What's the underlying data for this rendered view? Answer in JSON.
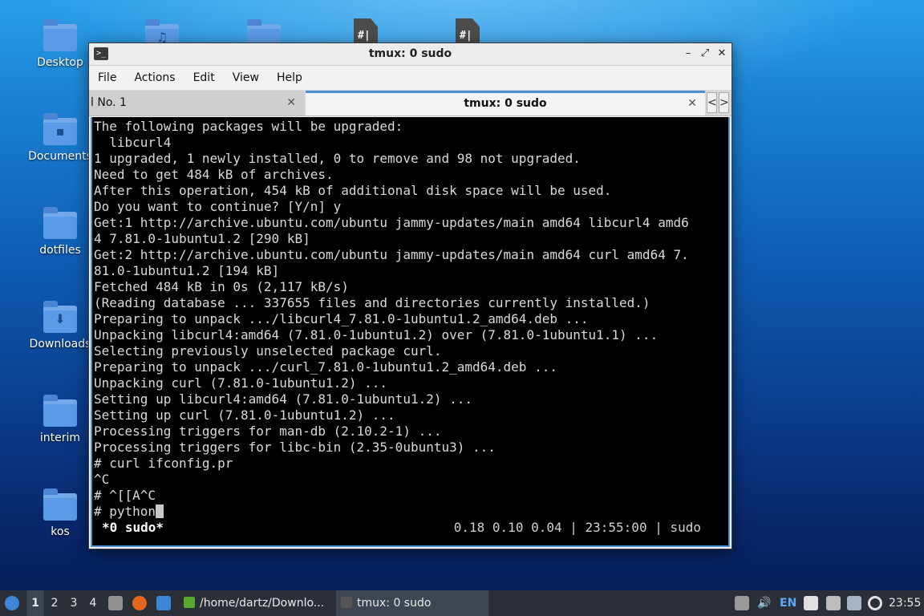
{
  "desktop": {
    "icons": [
      {
        "label": "Desktop",
        "glyph": ""
      },
      {
        "label": "Documents",
        "glyph": "▪"
      },
      {
        "label": "dotfiles",
        "glyph": ""
      },
      {
        "label": "Downloads",
        "glyph": "⬇"
      },
      {
        "label": "interim",
        "glyph": ""
      },
      {
        "label": "kos",
        "glyph": ""
      }
    ],
    "top_icons": {
      "music_glyph": "♫",
      "file_glyph": "#|"
    }
  },
  "window": {
    "title": "tmux: 0 sudo",
    "app_icon": ">_",
    "controls": {
      "minimize": "–",
      "maximize": "⤢",
      "close": "✕"
    },
    "menu": [
      "File",
      "Actions",
      "Edit",
      "View",
      "Help"
    ],
    "tabs": [
      {
        "label": "l No. 1",
        "close": "✕"
      },
      {
        "label": "tmux: 0 sudo",
        "close": "✕"
      }
    ],
    "tab_arrows": {
      "left": "<",
      "right": ">"
    }
  },
  "terminal": {
    "lines": [
      "The following packages will be upgraded:",
      "  libcurl4",
      "1 upgraded, 1 newly installed, 0 to remove and 98 not upgraded.",
      "Need to get 484 kB of archives.",
      "After this operation, 454 kB of additional disk space will be used.",
      "Do you want to continue? [Y/n] y",
      "Get:1 http://archive.ubuntu.com/ubuntu jammy-updates/main amd64 libcurl4 amd6",
      "4 7.81.0-1ubuntu1.2 [290 kB]",
      "Get:2 http://archive.ubuntu.com/ubuntu jammy-updates/main amd64 curl amd64 7.",
      "81.0-1ubuntu1.2 [194 kB]",
      "Fetched 484 kB in 0s (2,117 kB/s)",
      "(Reading database ... 337655 files and directories currently installed.)",
      "Preparing to unpack .../libcurl4_7.81.0-1ubuntu1.2_amd64.deb ...",
      "Unpacking libcurl4:amd64 (7.81.0-1ubuntu1.2) over (7.81.0-1ubuntu1.1) ...",
      "Selecting previously unselected package curl.",
      "Preparing to unpack .../curl_7.81.0-1ubuntu1.2_amd64.deb ...",
      "Unpacking curl (7.81.0-1ubuntu1.2) ...",
      "Setting up libcurl4:amd64 (7.81.0-1ubuntu1.2) ...",
      "Setting up curl (7.81.0-1ubuntu1.2) ...",
      "Processing triggers for man-db (2.10.2-1) ...",
      "Processing triggers for libc-bin (2.35-0ubuntu3) ...",
      "# curl ifconfig.pr",
      "^C",
      "# ^[[A^C"
    ],
    "prompt_line": "# python",
    "status_left": "*0 sudo*",
    "status_right": "0.18 0.10 0.04 | 23:55:00 | sudo"
  },
  "taskbar": {
    "workspaces": [
      "1",
      "2",
      "3",
      "4"
    ],
    "current_workspace": "1",
    "tasks": [
      {
        "label": "/home/dartz/Downlo..."
      },
      {
        "label": "tmux: 0 sudo"
      }
    ],
    "tray": {
      "keyboard_layout": "EN"
    },
    "clock": "23:55"
  }
}
